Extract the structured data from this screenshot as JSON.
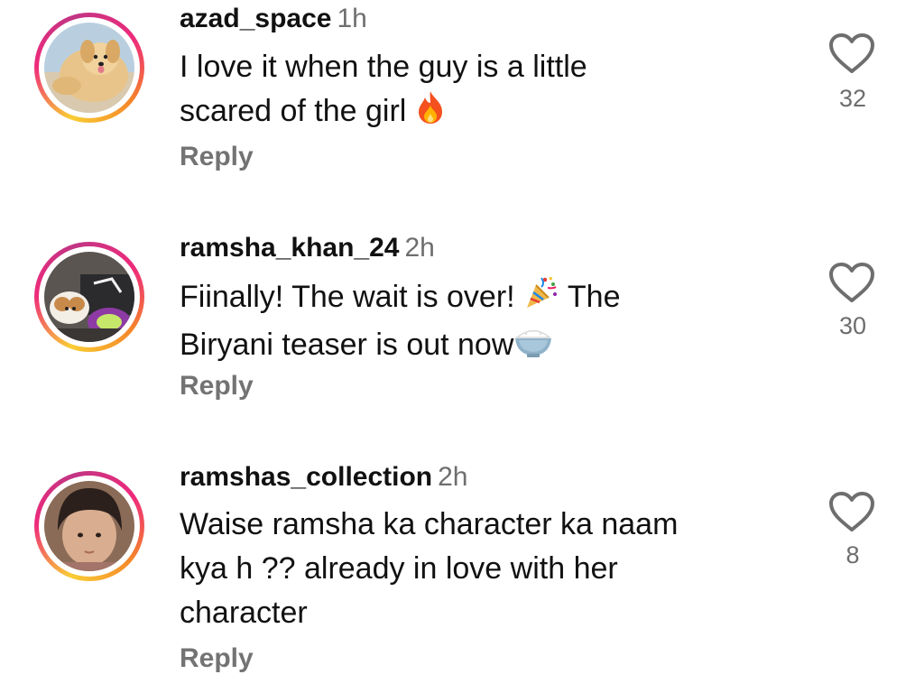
{
  "comments": [
    {
      "username": "azad_space",
      "time": "1h",
      "lines": [
        "I love it when the guy is a little",
        "scared of the girl"
      ],
      "emoji": "fire-emoji",
      "reply_label": "Reply",
      "likes": "32",
      "avatar": "dog-photo"
    },
    {
      "username": "ramsha_khan_24",
      "time": "2h",
      "lines": [
        "Fiinally! The wait is over!",
        "The",
        "Biryani teaser is out now"
      ],
      "emoji": [
        "party-popper-emoji",
        "rice-bowl-emoji"
      ],
      "reply_label": "Reply",
      "likes": "30",
      "avatar": "dog-with-bag-photo"
    },
    {
      "username": "ramshas_collection",
      "time": "2h",
      "lines": [
        "Waise ramsha ka character ka naam",
        "kya h ?? already in love with her",
        "character"
      ],
      "reply_label": "Reply",
      "likes": "8",
      "avatar": "child-photo"
    }
  ],
  "colors": {
    "text": "#111111",
    "muted": "#737373",
    "story_ring": [
      "#f9ce34",
      "#ee2a7b",
      "#c13584"
    ]
  },
  "icons": {
    "like": "heart-outline-icon"
  }
}
